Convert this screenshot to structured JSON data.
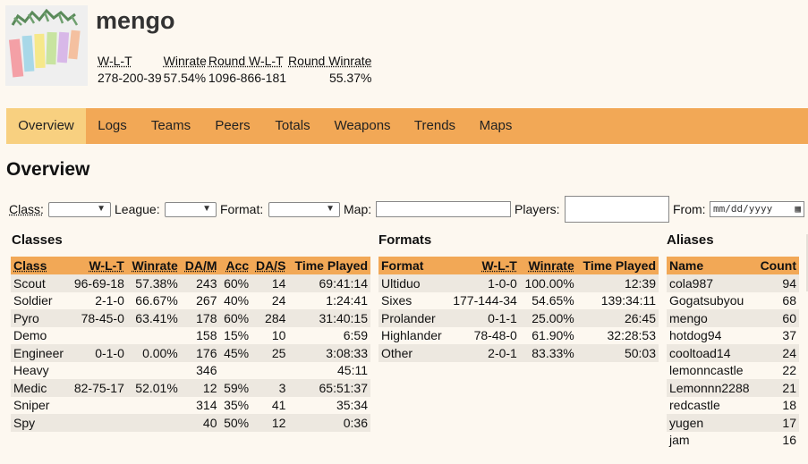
{
  "player": {
    "name": "mengo",
    "avatar_icon": "tanabata-streamers-icon",
    "stats_headers": [
      "W-L-T",
      "Winrate",
      "Round W-L-T",
      "Round Winrate"
    ],
    "stats_values": [
      "278-200-39",
      "57.54%",
      "1096-866-181",
      "55.37%"
    ]
  },
  "nav": {
    "items": [
      "Overview",
      "Logs",
      "Teams",
      "Peers",
      "Totals",
      "Weapons",
      "Trends",
      "Maps"
    ],
    "active": "Overview",
    "color": "#f2a856",
    "active_color": "#f8d080"
  },
  "page_title": "Overview",
  "filters": {
    "class_label": "Class:",
    "league_label": "League:",
    "format_label": "Format:",
    "map_label": "Map:",
    "players_label": "Players:",
    "from_label": "From:",
    "from_placeholder": "mm/dd/yyyy"
  },
  "classes": {
    "title": "Classes",
    "headers": [
      "Class",
      "W-L-T",
      "Winrate",
      "DA/M",
      "Acc",
      "DA/S",
      "Time Played"
    ],
    "rows": [
      [
        "Scout",
        "96-69-18",
        "57.38%",
        "243",
        "60%",
        "14",
        "69:41:14"
      ],
      [
        "Soldier",
        "2-1-0",
        "66.67%",
        "267",
        "40%",
        "24",
        "1:24:41"
      ],
      [
        "Pyro",
        "78-45-0",
        "63.41%",
        "178",
        "60%",
        "284",
        "31:40:15"
      ],
      [
        "Demo",
        "",
        "",
        "158",
        "15%",
        "10",
        "6:59"
      ],
      [
        "Engineer",
        "0-1-0",
        "0.00%",
        "176",
        "45%",
        "25",
        "3:08:33"
      ],
      [
        "Heavy",
        "",
        "",
        "346",
        "",
        "",
        "45:11"
      ],
      [
        "Medic",
        "82-75-17",
        "52.01%",
        "12",
        "59%",
        "3",
        "65:51:37"
      ],
      [
        "Sniper",
        "",
        "",
        "314",
        "35%",
        "41",
        "35:34"
      ],
      [
        "Spy",
        "",
        "",
        "40",
        "50%",
        "12",
        "0:36"
      ]
    ]
  },
  "formats": {
    "title": "Formats",
    "headers": [
      "Format",
      "W-L-T",
      "Winrate",
      "Time Played"
    ],
    "rows": [
      [
        "Ultiduo",
        "1-0-0",
        "100.00%",
        "12:39"
      ],
      [
        "Sixes",
        "177-144-34",
        "54.65%",
        "139:34:11"
      ],
      [
        "Prolander",
        "0-1-1",
        "25.00%",
        "26:45"
      ],
      [
        "Highlander",
        "78-48-0",
        "61.90%",
        "32:28:53"
      ],
      [
        "Other",
        "2-0-1",
        "83.33%",
        "50:03"
      ]
    ]
  },
  "aliases": {
    "title": "Aliases",
    "headers": [
      "Name",
      "Count"
    ],
    "rows": [
      [
        "cola987",
        "94"
      ],
      [
        "Gogatsubyou",
        "68"
      ],
      [
        "mengo",
        "60"
      ],
      [
        "hotdog94",
        "37"
      ],
      [
        "cooltoad14",
        "24"
      ],
      [
        "lemonncastle",
        "22"
      ],
      [
        "Lemonnn2288",
        "21"
      ],
      [
        "redcastle",
        "18"
      ],
      [
        "yugen",
        "17"
      ],
      [
        "jam",
        "16"
      ]
    ]
  }
}
